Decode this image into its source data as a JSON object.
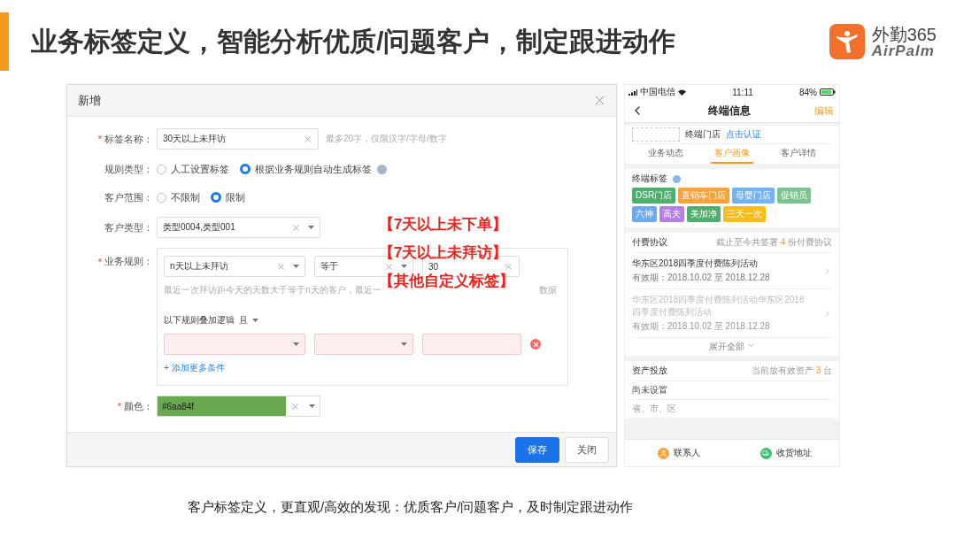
{
  "slide": {
    "title": "业务标签定义，智能分析优质/问题客户，制定跟进动作",
    "logo": {
      "name": "外勤",
      "number": "365",
      "brand": "AirPalm"
    },
    "caption": "客户标签定义，更直观/高效的发现：优质客户/问题客户，及时制定跟进动作"
  },
  "dialog": {
    "title": "新增",
    "fields": [
      {
        "kind": "text",
        "label": "标签名称：",
        "required_mark": "*",
        "value": "30天以上未拜访",
        "hint": "最多20字，仅限汉字/字母/数字"
      },
      {
        "kind": "radio",
        "label": "规则类型：",
        "help": true,
        "options": [
          {
            "label": "人工设置标签",
            "selected": false
          },
          {
            "label": "根据业务规则自动生成标签",
            "selected": true
          }
        ]
      },
      {
        "kind": "radio",
        "label": "客户范围：",
        "options": [
          {
            "label": "不限制",
            "selected": false
          },
          {
            "label": "限制",
            "selected": true
          }
        ]
      },
      {
        "kind": "select",
        "label": "客户类型：",
        "value": "类型0004,类型001"
      },
      {
        "kind": "rules",
        "label": "业务规则：",
        "required_mark": "*",
        "rule": {
          "field": "n天以上未拜访",
          "operator": "等于",
          "value": "30"
        },
        "hint": "最近一次拜访距今天的天数大于等于n天的客户，最近一",
        "hint_end": "数据",
        "logic_label": "以下规则叠加逻辑",
        "logic": "且",
        "extra_invalid": true,
        "add_link": "+ 添加更多条件"
      },
      {
        "kind": "color",
        "label": "颜色：",
        "required_mark": "*",
        "value": "#6aa84f"
      }
    ],
    "buttons": [
      {
        "label": "保存",
        "primary": true
      },
      {
        "label": "关闭",
        "primary": false
      }
    ]
  },
  "annotations": [
    "【7天以上未下单】",
    "【7天以上未拜访】",
    "【其他自定义标签】"
  ],
  "phone": {
    "status": {
      "carrier": "中国电信",
      "time": "11:11",
      "battery": "84%"
    },
    "nav": {
      "title": "终端信息",
      "action": "编辑"
    },
    "store": {
      "name": "终端门店",
      "link": "点击认证"
    },
    "tabs": [
      {
        "label": "业务动态",
        "selected": false
      },
      {
        "label": "客户画像",
        "selected": true
      },
      {
        "label": "客户详情",
        "selected": false
      }
    ],
    "tags": {
      "title": "终端标签",
      "items": [
        {
          "label": "DSR门店",
          "color": "#4fae6e"
        },
        {
          "label": "直销车门店",
          "color": "#f7a23b"
        },
        {
          "label": "母婴门店",
          "color": "#74b3f2"
        },
        {
          "label": "促销员",
          "color": "#7cc48f"
        },
        {
          "label": "六神",
          "color": "#6ea9f0"
        },
        {
          "label": "高夫",
          "color": "#b47fe0"
        },
        {
          "label": "美加净",
          "color": "#4fae6e"
        },
        {
          "label": "三天一次",
          "color": "#f8bd1c"
        }
      ]
    },
    "agreements": {
      "title": "付费协议",
      "summary": {
        "prefix": "截止至今共签署",
        "count": "4",
        "suffix": "份付费协议"
      },
      "items": [
        {
          "title": "华东区2018四季度付费陈列活动",
          "period": "有效期：2018.10.02 至 2018.12.28",
          "expired": false
        },
        {
          "title": "华东区2018四季度付费陈列活动华东区2018四季度付费陈列活动",
          "period": "有效期：2018.10.02 至 2018.12.28",
          "expired": true
        }
      ],
      "more": "展开全部"
    },
    "assets": {
      "title": "资产投放",
      "summary": {
        "prefix": "当前放有效资产",
        "count": "3",
        "suffix": "台"
      },
      "rows": [
        "尚未设置",
        "省、市、区"
      ]
    },
    "bottom": [
      {
        "kind": "contact",
        "label": "联系人"
      },
      {
        "kind": "address",
        "label": "收货地址"
      }
    ]
  }
}
